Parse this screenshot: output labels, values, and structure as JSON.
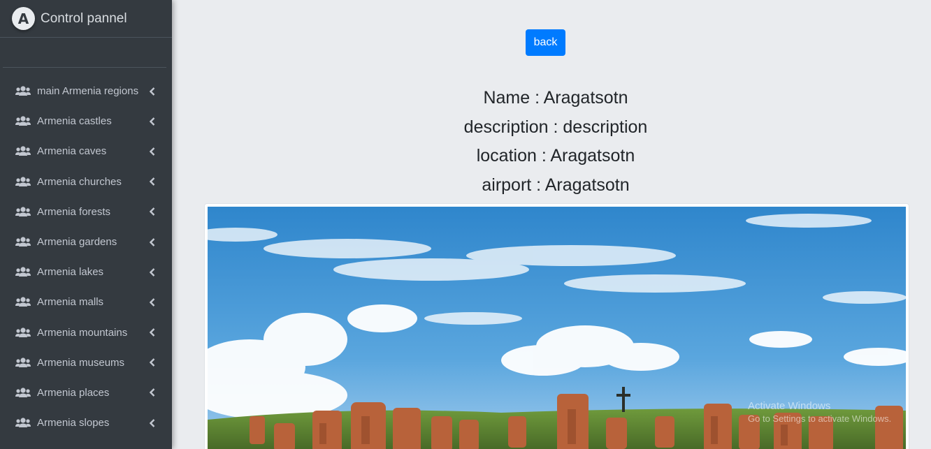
{
  "brand": {
    "logo_letter": "A",
    "title": "Control pannel"
  },
  "sidebar": {
    "items": [
      {
        "label": "main Armenia regions",
        "icon": "users-icon"
      },
      {
        "label": "Armenia castles",
        "icon": "users-icon"
      },
      {
        "label": "Armenia caves",
        "icon": "users-icon"
      },
      {
        "label": "Armenia churches",
        "icon": "users-icon"
      },
      {
        "label": "Armenia forests",
        "icon": "users-icon"
      },
      {
        "label": "Armenia gardens",
        "icon": "users-icon"
      },
      {
        "label": "Armenia lakes",
        "icon": "users-icon"
      },
      {
        "label": "Armenia malls",
        "icon": "users-icon"
      },
      {
        "label": "Armenia mountains",
        "icon": "users-icon"
      },
      {
        "label": "Armenia museums",
        "icon": "users-icon"
      },
      {
        "label": "Armenia places",
        "icon": "users-icon"
      },
      {
        "label": "Armenia slopes",
        "icon": "users-icon"
      }
    ]
  },
  "main": {
    "back_label": "back",
    "details": {
      "name": "Name : Aragatsotn",
      "description": "description : description",
      "location": "location : Aragatsotn",
      "airport": "airport : Aragatsotn"
    }
  },
  "watermark": {
    "line1": "Activate Windows",
    "line2": "Go to Settings to activate Windows."
  },
  "colors": {
    "sidebar_bg": "#343a40",
    "content_bg": "#eaecef",
    "primary": "#007bff",
    "sky": "#3d8fd1"
  }
}
